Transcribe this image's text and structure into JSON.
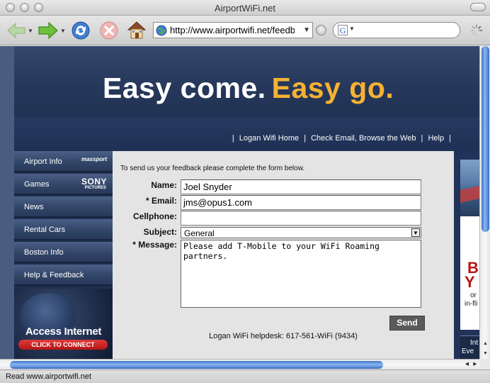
{
  "window": {
    "title": "AirportWiFi.net"
  },
  "toolbar": {
    "url": "http://www.airportwifi.net/feedback",
    "search_logo": "G",
    "icons": [
      "back-icon",
      "forward-icon",
      "reload-icon",
      "stop-icon",
      "home-icon",
      "globe-icon",
      "go-icon",
      "google-icon",
      "spinner-icon"
    ]
  },
  "header": {
    "tagline_white": "Easy come.",
    "tagline_orange": "Easy go.",
    "tagline_orange_color": "#f6b233",
    "nav": [
      {
        "label": "Logan Wifi Home"
      },
      {
        "label": "Check Email, Browse the Web"
      },
      {
        "label": "Help"
      }
    ]
  },
  "sidebar": {
    "items": [
      {
        "label": "Airport Info",
        "logo": "massport"
      },
      {
        "label": "Games",
        "logo": "SONY",
        "logo_sub": "PICTURES"
      },
      {
        "label": "News"
      },
      {
        "label": "Rental Cars"
      },
      {
        "label": "Boston Info"
      },
      {
        "label": "Help & Feedback"
      }
    ],
    "access_title": "Access Internet",
    "access_button": "CLICK TO CONNECT"
  },
  "form": {
    "intro": "To send us your feedback please complete the form below.",
    "name_label": "Name:",
    "name_value": "Joel Snyder",
    "email_label": "* Email:",
    "email_value": "jms@opus1.com",
    "cellphone_label": "Cellphone:",
    "cellphone_value": "",
    "subject_label": "Subject:",
    "subject_value": "General",
    "message_label": "* Message:",
    "message_value": "Please add T-Mobile to your WiFi Roaming\npartners.",
    "send_label": "Send",
    "helpdesk": "Logan WiFi helpdesk: 617-561-WiFi (9434)"
  },
  "ad": {
    "big1": "B",
    "big2": "Y",
    "small1": "or",
    "small2": "in-fli",
    "bottom1": "Int",
    "bottom2": "Eve"
  },
  "statusbar": {
    "text": "Read www.airportwifi.net"
  },
  "colors": {
    "header_bg": "#25375a",
    "sidebar_item": "#324668",
    "send_button": "#5b5b5b",
    "connect_red": "#c62020",
    "scroll_blue": "#3e72c6"
  }
}
